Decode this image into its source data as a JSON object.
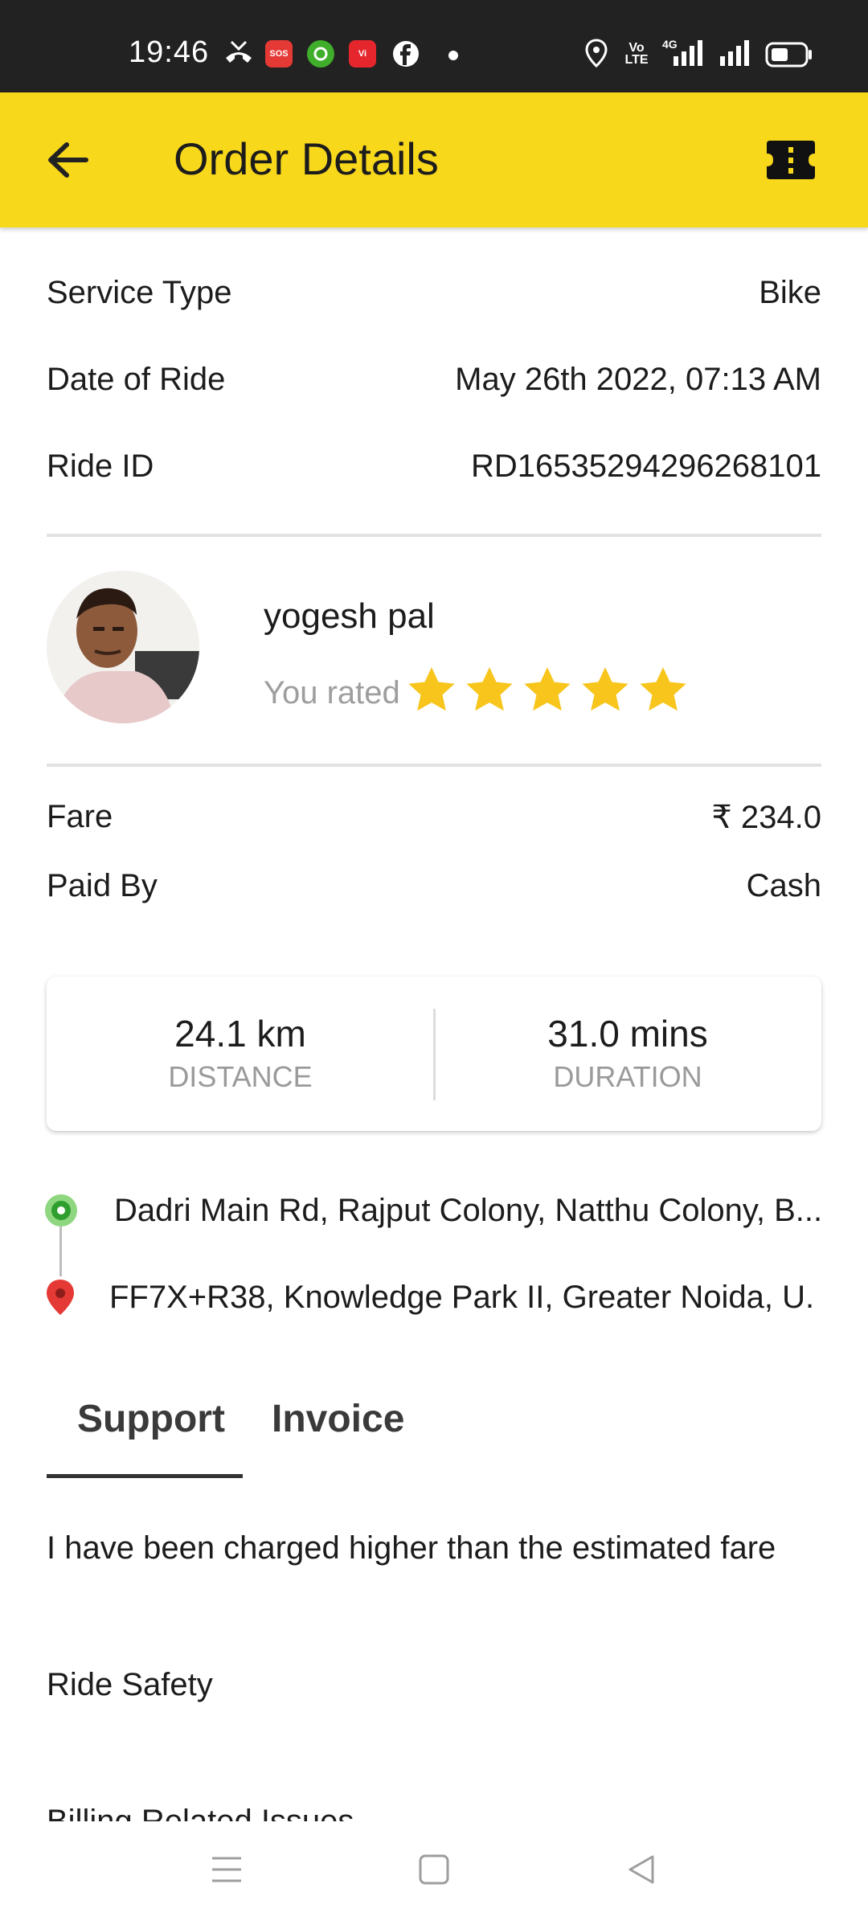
{
  "status_bar": {
    "time": "19:46",
    "volte_label": "Vo LTE",
    "network_label": "4G"
  },
  "header": {
    "title": "Order Details"
  },
  "details": {
    "service_type_label": "Service Type",
    "service_type_value": "Bike",
    "date_label": "Date of Ride",
    "date_value": "May 26th 2022, 07:13 AM",
    "ride_id_label": "Ride ID",
    "ride_id_value": "RD1653529429626810​1"
  },
  "driver": {
    "name": "yogesh pal",
    "rated_label": "You rated",
    "rating": 5,
    "rating_max": 5
  },
  "payment": {
    "fare_label": "Fare",
    "fare_value": "₹ 234.0",
    "paid_by_label": "Paid By",
    "paid_by_value": "Cash"
  },
  "stats": {
    "distance_value": "24.1 km",
    "distance_label": "DISTANCE",
    "duration_value": "31.0 mins",
    "duration_label": "DURATION"
  },
  "locations": {
    "pickup": "Dadri Main Rd, Rajput Colony, Natthu Colony, B...",
    "drop": "FF7X+R38, Knowledge Park II, Greater Noida, U..."
  },
  "tabs": [
    {
      "label": "Support",
      "active": true
    },
    {
      "label": "Invoice",
      "active": false
    }
  ],
  "support_items": [
    "I have been charged higher than the estimated fare",
    "Ride Safety",
    "Billing Related Issues"
  ],
  "colors": {
    "accent_yellow": "#f8d81b",
    "star": "#f7c51b",
    "pickup_green": "#4caf50",
    "drop_red": "#e53935"
  }
}
